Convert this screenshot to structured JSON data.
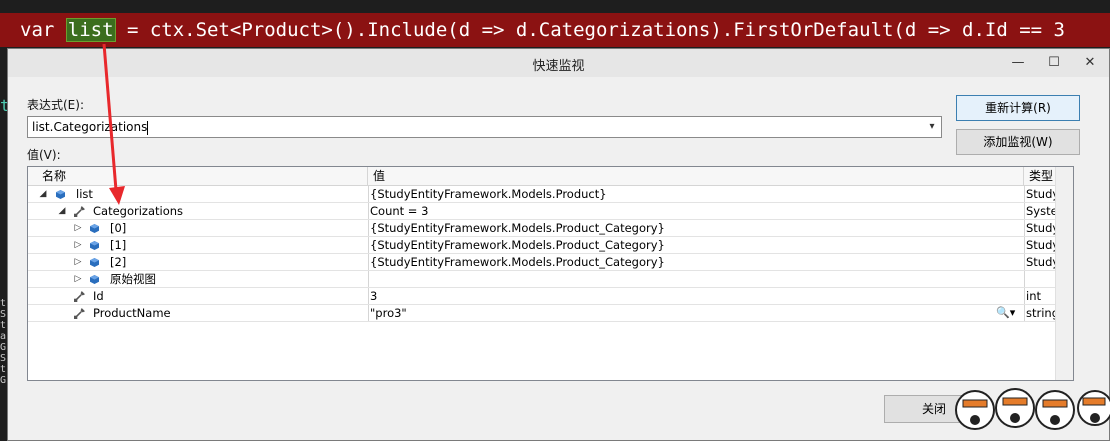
{
  "code": {
    "pre": "var ",
    "highlight": "list",
    "post": " = ctx.Set<Product>().Include(d => d.Categorizations).FirstOrDefault(d => d.Id == 3"
  },
  "dialog": {
    "title": "快速监视",
    "expression_label": "表达式(E):",
    "expression_value": "list.Categorizations",
    "value_label": "值(V):",
    "recalc_button": "重新计算(R)",
    "add_watch_button": "添加监视(W)",
    "close_button": "关闭"
  },
  "grid": {
    "columns": {
      "name": "名称",
      "value": "值",
      "type": "类型"
    },
    "rows": [
      {
        "name": "list",
        "value": "{StudyEntityFramework.Models.Product}",
        "type": "StudyEnt"
      },
      {
        "name": "Categorizations",
        "value": "Count = 3",
        "type": "System.C"
      },
      {
        "name": "[0]",
        "value": "{StudyEntityFramework.Models.Product_Category}",
        "type": "StudyEnt"
      },
      {
        "name": "[1]",
        "value": "{StudyEntityFramework.Models.Product_Category}",
        "type": "StudyEnt"
      },
      {
        "name": "[2]",
        "value": "{StudyEntityFramework.Models.Product_Category}",
        "type": "StudyEnt"
      },
      {
        "name": "原始视图",
        "value": "",
        "type": ""
      },
      {
        "name": "Id",
        "value": "3",
        "type": "int"
      },
      {
        "name": "ProductName",
        "value": "\"pro3\"",
        "type": "string"
      }
    ]
  },
  "colors": {
    "code_bg": "#8b1212",
    "highlight_bg": "#3c6e1e",
    "arrow": "#e8282c",
    "object_icon": "#2a6ebd",
    "wrench_icon": "#555555"
  }
}
